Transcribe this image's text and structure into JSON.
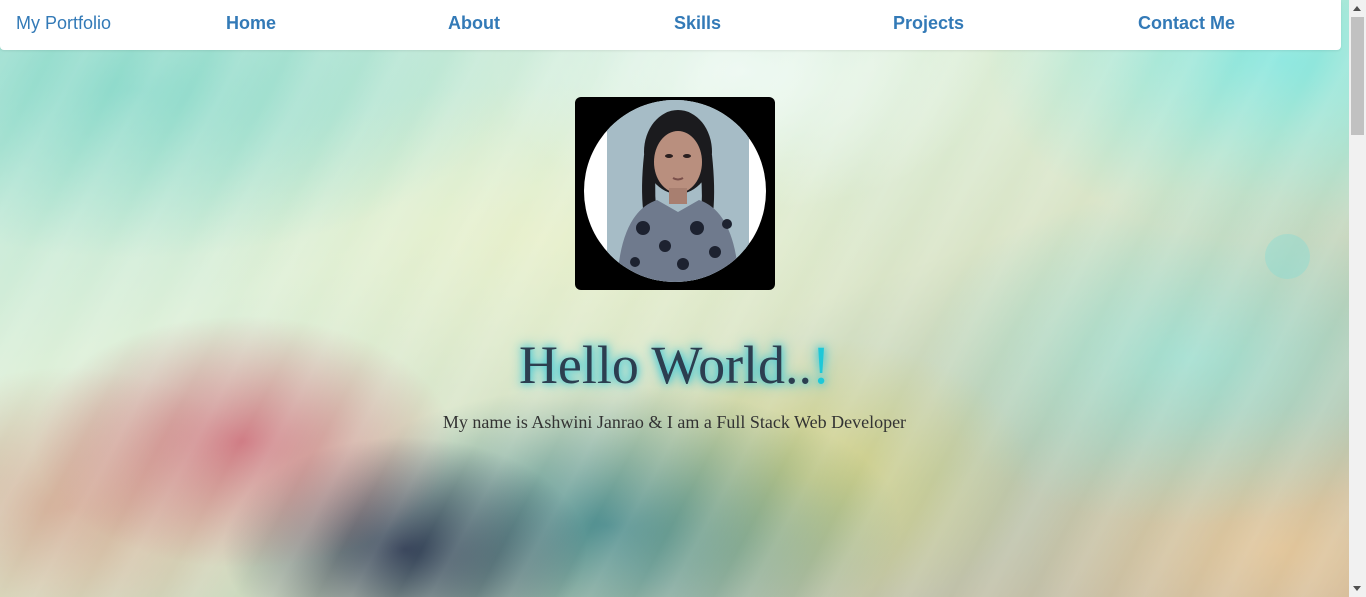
{
  "navbar": {
    "brand": "My Portfolio",
    "links": [
      "Home",
      "About",
      "Skills",
      "Projects",
      "Contact Me"
    ]
  },
  "hero": {
    "title_main": "Hello World..",
    "title_accent": "!",
    "subtitle": "My name is Ashwini Janrao & I am a Full Stack Web Developer",
    "profile_image": "profile-photo"
  },
  "colors": {
    "link": "#337ab7",
    "title": "#2c3e50",
    "title_glow": "#35c6d6",
    "accent": "#1ec8d8",
    "frame": "#000000"
  }
}
